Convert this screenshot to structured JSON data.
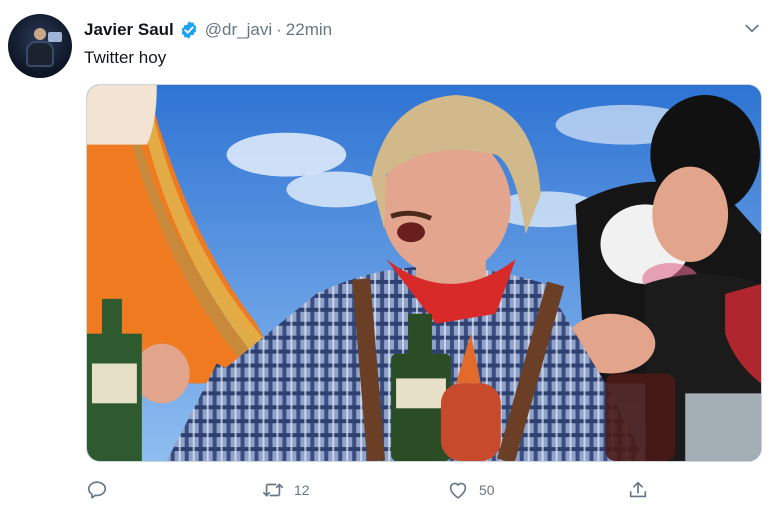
{
  "tweet": {
    "author_name": "Javier Saul",
    "handle": "@dr_javi",
    "separator": "·",
    "time": "22min",
    "text": "Twitter hoy",
    "verified_color": "#1da1f2"
  },
  "actions": {
    "reply_count": "",
    "retweet_count": "12",
    "like_count": "50"
  },
  "icons": [
    "verified-badge-icon",
    "chevron-down-icon",
    "reply-icon",
    "retweet-icon",
    "like-icon",
    "share-icon"
  ]
}
